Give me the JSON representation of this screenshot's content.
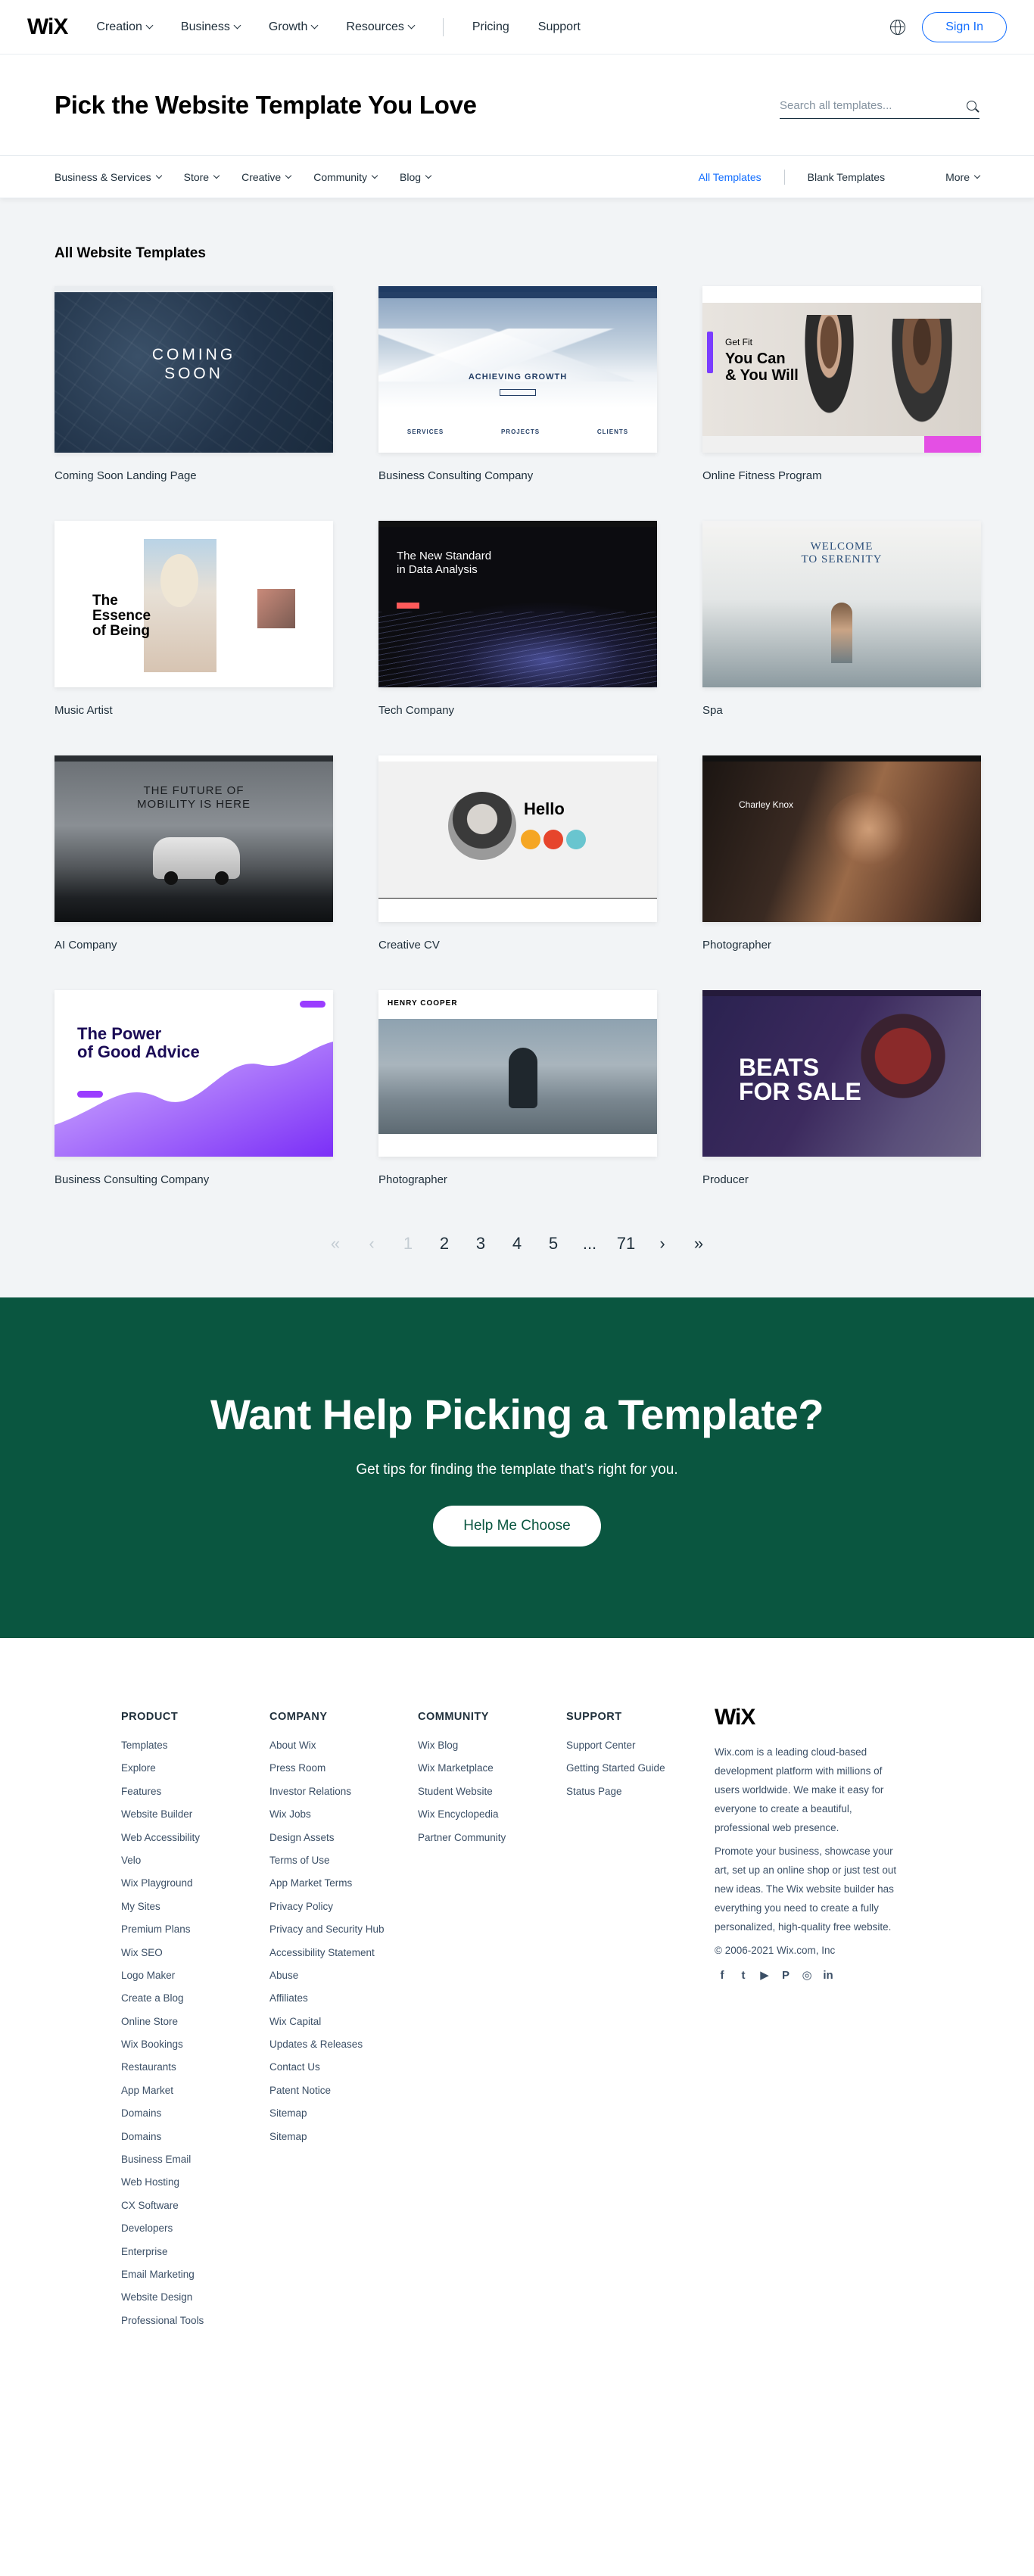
{
  "nav": {
    "logo": "WiX",
    "items": [
      {
        "label": "Creation",
        "dropdown": true
      },
      {
        "label": "Business",
        "dropdown": true
      },
      {
        "label": "Growth",
        "dropdown": true
      },
      {
        "label": "Resources",
        "dropdown": true
      }
    ],
    "links": [
      "Pricing",
      "Support"
    ],
    "sign_in": "Sign In"
  },
  "hero": {
    "title": "Pick the Website Template You Love",
    "search_placeholder": "Search all templates..."
  },
  "categories": {
    "items": [
      "Business & Services",
      "Store",
      "Creative",
      "Community",
      "Blog"
    ],
    "all_templates": "All Templates",
    "blank_templates": "Blank Templates",
    "more": "More"
  },
  "gallery": {
    "heading": "All Website Templates",
    "templates": [
      {
        "title": "Coming Soon Landing Page",
        "shot_text": [
          "COMING",
          "SOON"
        ]
      },
      {
        "title": "Business Consulting Company",
        "shot_text": [
          "ACHIEVING GROWTH",
          "SERVICES",
          "PROJECTS",
          "CLIENTS"
        ]
      },
      {
        "title": "Online Fitness Program",
        "shot_text": [
          "Get Fit",
          "You Can",
          "& You Will"
        ]
      },
      {
        "title": "Music Artist",
        "shot_text": [
          "The",
          "Essence",
          "of Being"
        ]
      },
      {
        "title": "Tech Company",
        "shot_text": [
          "The New Standard",
          "in Data Analysis"
        ]
      },
      {
        "title": "Spa",
        "shot_text": [
          "WELCOME",
          "TO SERENITY"
        ]
      },
      {
        "title": "AI Company",
        "shot_text": [
          "THE FUTURE OF",
          "MOBILITY IS HERE"
        ]
      },
      {
        "title": "Creative CV",
        "shot_text": [
          "Hello"
        ]
      },
      {
        "title": "Photographer",
        "shot_text": [
          "Charley Knox"
        ]
      },
      {
        "title": "Business Consulting Company",
        "shot_text": [
          "The Power",
          "of Good Advice"
        ]
      },
      {
        "title": "Photographer",
        "shot_text": [
          "HENRY COOPER"
        ]
      },
      {
        "title": "Producer",
        "shot_text": [
          "BEATS",
          "FOR SALE"
        ]
      }
    ]
  },
  "pagination": {
    "first": "«",
    "prev": "‹",
    "pages": [
      "1",
      "2",
      "3",
      "4",
      "5",
      "...",
      "71"
    ],
    "current": "1",
    "next": "›",
    "last": "»"
  },
  "help": {
    "title": "Want Help Picking a Template?",
    "subtitle": "Get tips for finding the template that’s right for you.",
    "button": "Help Me Choose"
  },
  "footer": {
    "columns": [
      {
        "heading": "PRODUCT",
        "links": [
          "Templates",
          "Explore",
          "Features",
          "Website Builder",
          "Web Accessibility",
          "Velo",
          "Wix Playground",
          "My Sites",
          "Premium Plans",
          "Wix SEO",
          "Logo Maker",
          "Create a Blog",
          "Online Store",
          "Wix Bookings",
          "Restaurants",
          "App Market",
          "Domains",
          "Domains",
          "Business Email",
          "Web Hosting",
          "CX Software",
          "Developers",
          "Enterprise",
          "Email Marketing",
          "Website Design",
          "Professional Tools"
        ]
      },
      {
        "heading": "COMPANY",
        "links": [
          "About Wix",
          "Press Room",
          "Investor Relations",
          "Wix Jobs",
          "Design Assets",
          "Terms of Use",
          "App Market Terms",
          "Privacy Policy",
          "Privacy and Security Hub",
          "Accessibility Statement",
          "Abuse",
          "Affiliates",
          "Wix Capital",
          "Updates & Releases",
          "Contact Us",
          "Patent Notice",
          "Sitemap",
          "Sitemap"
        ]
      },
      {
        "heading": "COMMUNITY",
        "links": [
          "Wix Blog",
          "Wix Marketplace",
          "Student Website",
          "Wix Encyclopedia",
          "Partner Community"
        ]
      },
      {
        "heading": "SUPPORT",
        "links": [
          "Support Center",
          "Getting Started Guide",
          "Status Page"
        ]
      }
    ],
    "logo": "WiX",
    "about_1": "Wix.com is a leading cloud-based development platform with millions of users worldwide. We make it easy for everyone to create a beautiful, professional web presence.",
    "about_2": "Promote your business, showcase your art, set up an online shop or just test out new ideas. The Wix website builder has everything you need to create a fully personalized, high-quality free website.",
    "copyright": "© 2006-2021 Wix.com, Inc",
    "socials": [
      {
        "icon": "facebook-icon",
        "glyph": "f"
      },
      {
        "icon": "twitter-icon",
        "glyph": "t"
      },
      {
        "icon": "youtube-icon",
        "glyph": "▶"
      },
      {
        "icon": "pinterest-icon",
        "glyph": "P"
      },
      {
        "icon": "instagram-icon",
        "glyph": "◎"
      },
      {
        "icon": "linkedin-icon",
        "glyph": "in"
      }
    ]
  },
  "colors": {
    "accent": "#116dff",
    "help_bg": "#0a5640"
  }
}
